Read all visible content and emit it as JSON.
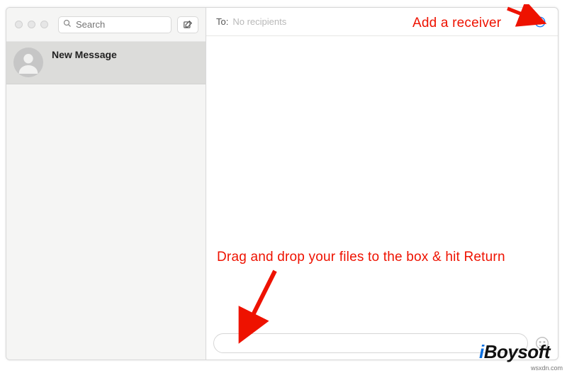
{
  "sidebar": {
    "search_placeholder": "Search",
    "conversation_title": "New Message"
  },
  "compose_area": {
    "to_label": "To:",
    "to_placeholder": "No recipients"
  },
  "annotations": {
    "add_receiver": "Add a receiver",
    "drag_drop": "Drag and drop your files to the box & hit Return"
  },
  "watermark": {
    "prefix": "i",
    "rest": "Boysoft"
  },
  "source_site": "wsxdn.com",
  "colors": {
    "annotation_red": "#ee1200",
    "accent_blue": "#137dfc"
  }
}
